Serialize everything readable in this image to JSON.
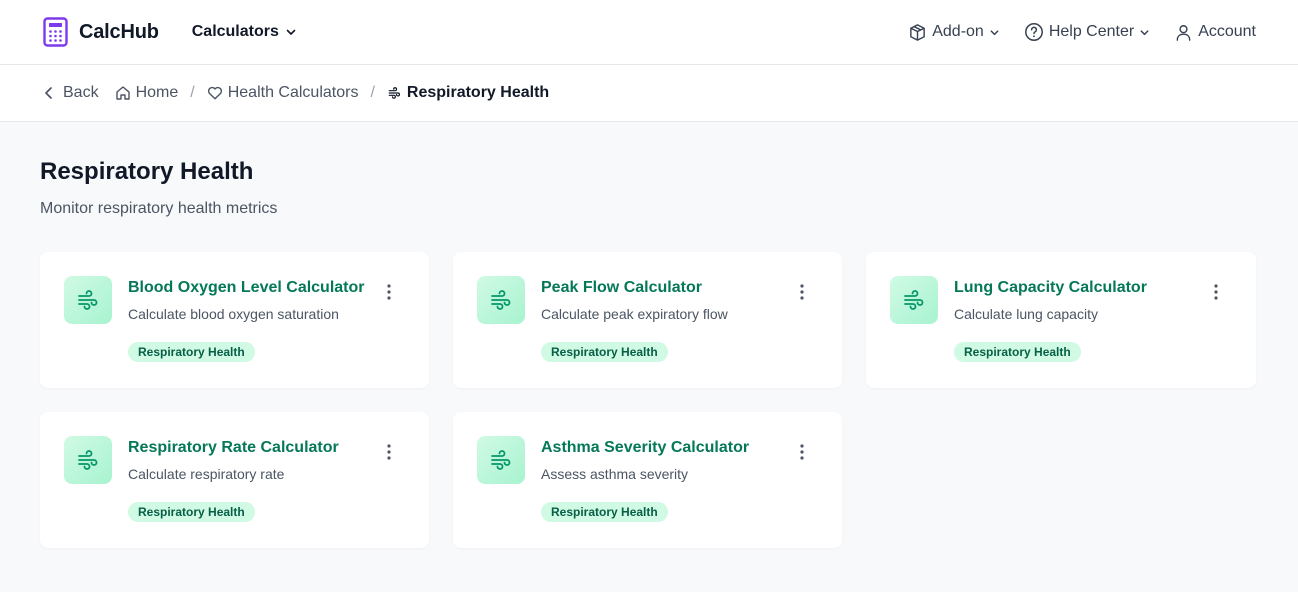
{
  "header": {
    "brand": "CalcHub",
    "calculators_label": "Calculators",
    "addon_label": "Add-on",
    "help_label": "Help Center",
    "account_label": "Account"
  },
  "breadcrumb": {
    "back": "Back",
    "home": "Home",
    "separator": "/",
    "health": "Health Calculators",
    "current": "Respiratory Health"
  },
  "page": {
    "title": "Respiratory Health",
    "subtitle": "Monitor respiratory health metrics"
  },
  "cards": [
    {
      "title": "Blood Oxygen Level Calculator",
      "desc": "Calculate blood oxygen saturation",
      "tag": "Respiratory Health",
      "icon": "wind-icon"
    },
    {
      "title": "Peak Flow Calculator",
      "desc": "Calculate peak expiratory flow",
      "tag": "Respiratory Health",
      "icon": "wind-icon"
    },
    {
      "title": "Lung Capacity Calculator",
      "desc": "Calculate lung capacity",
      "tag": "Respiratory Health",
      "icon": "wind-icon"
    },
    {
      "title": "Respiratory Rate Calculator",
      "desc": "Calculate respiratory rate",
      "tag": "Respiratory Health",
      "icon": "wind-icon"
    },
    {
      "title": "Asthma Severity Calculator",
      "desc": "Assess asthma severity",
      "tag": "Respiratory Health",
      "icon": "wind-icon"
    }
  ],
  "colors": {
    "brand_purple": "#7c3aed",
    "accent_green": "#047857",
    "tag_bg": "#d1fae5"
  }
}
